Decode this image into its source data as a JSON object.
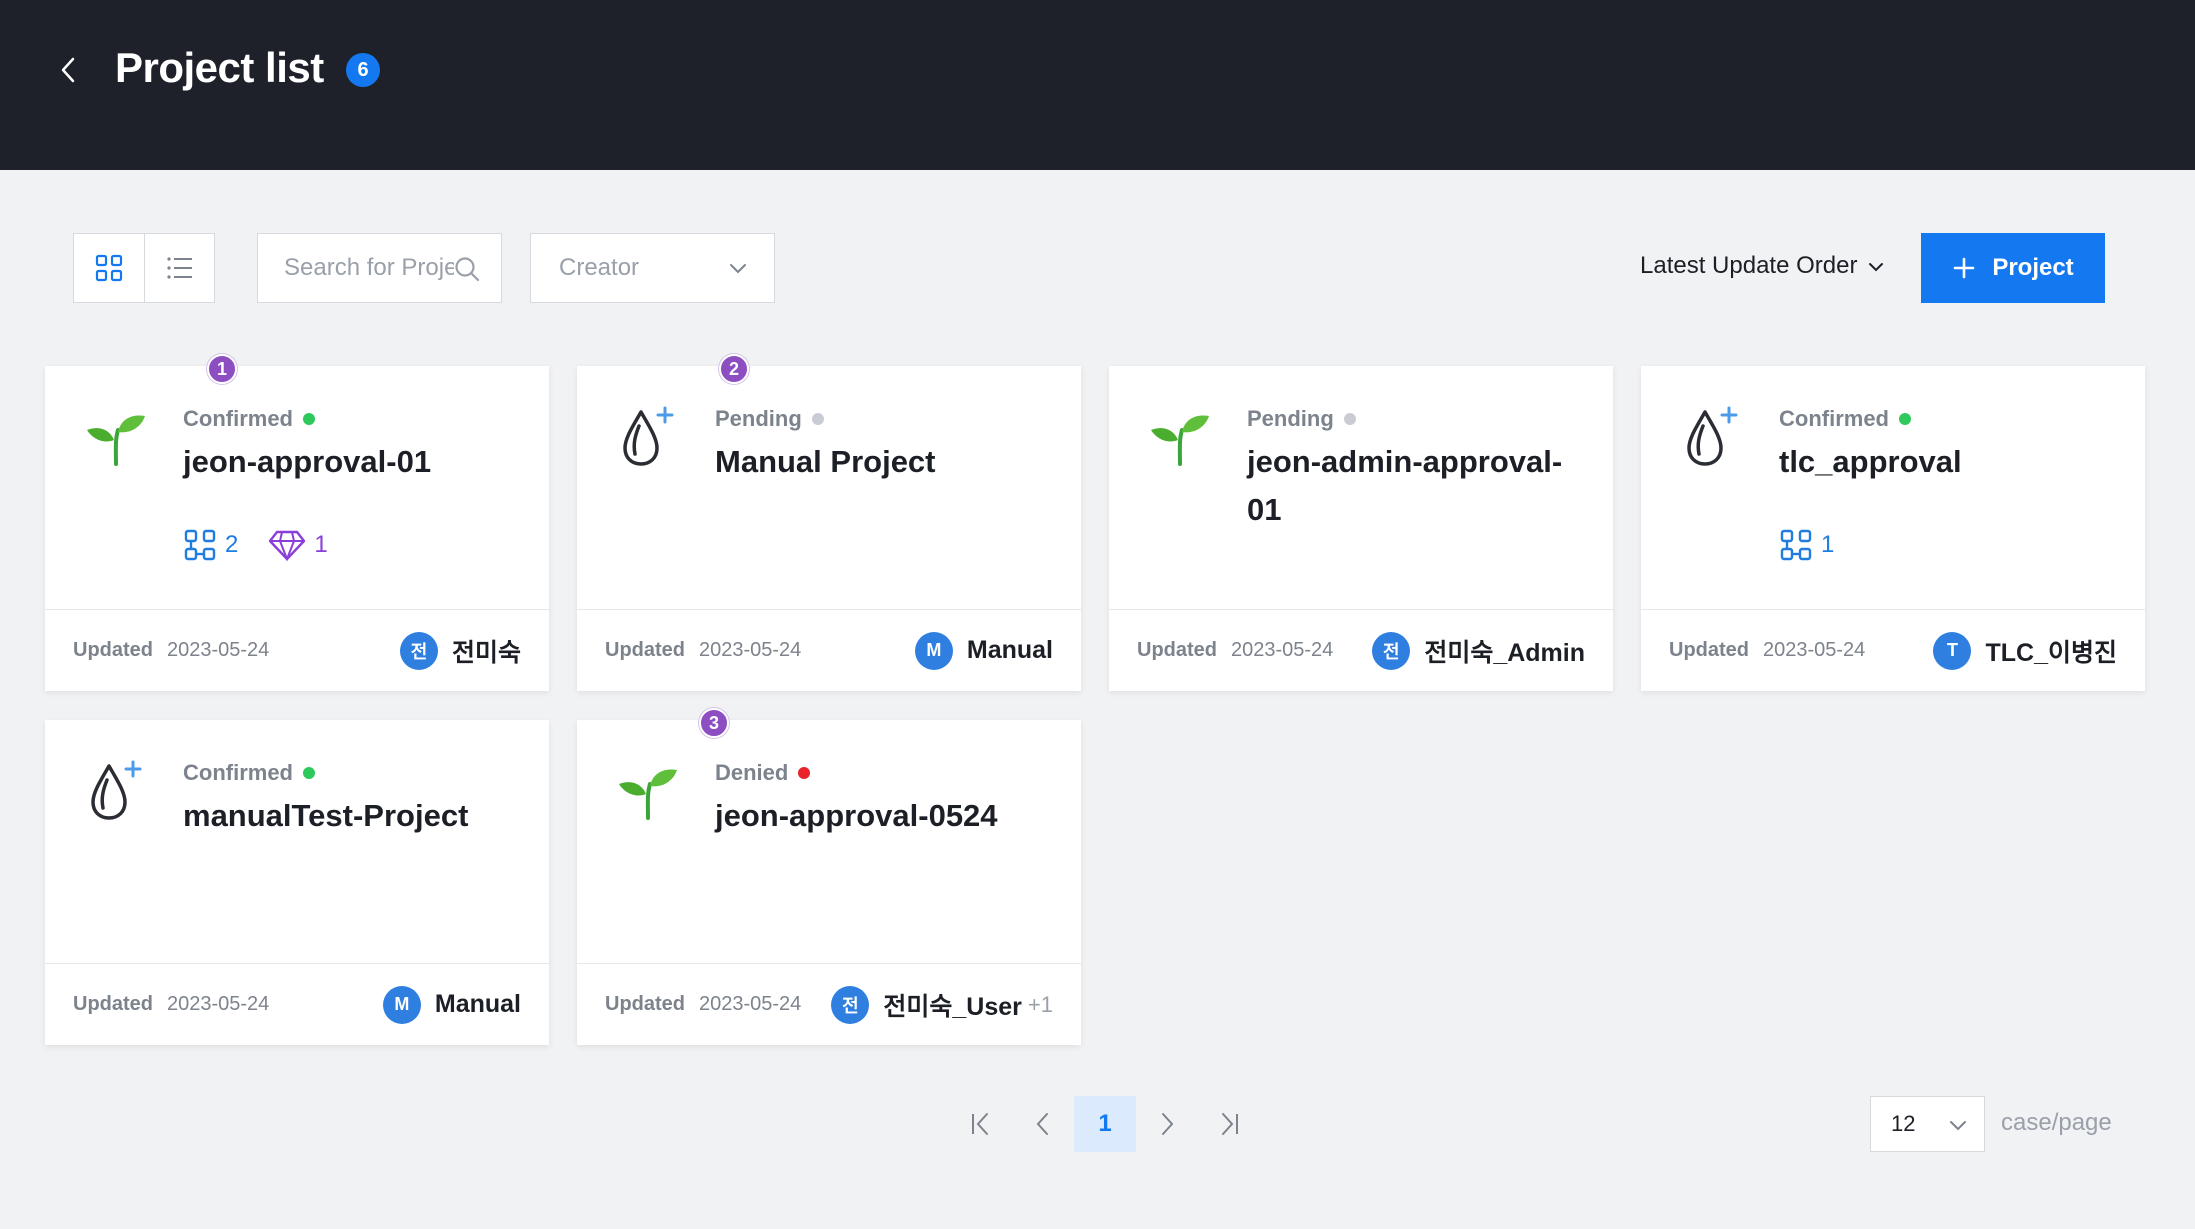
{
  "header": {
    "title": "Project list",
    "count": "6"
  },
  "toolbar": {
    "search_placeholder": "Search for Project",
    "creator_label": "Creator",
    "sort_label": "Latest Update Order",
    "add_project_label": "Project"
  },
  "cards": [
    {
      "status": "Confirmed",
      "status_color": "#2ec95c",
      "notif": "1",
      "name": "jeon-approval-01",
      "icon": "sprout-icon",
      "stats": {
        "models": "2",
        "gems": "1"
      },
      "updated_label": "Updated",
      "updated": "2023-05-24",
      "avatar": "전",
      "creator": "전미숙",
      "extra": ""
    },
    {
      "status": "Pending",
      "status_color": "#c9cdd3",
      "notif": "2",
      "name": "Manual Project",
      "icon": "drop-sparkle-icon",
      "updated_label": "Updated",
      "updated": "2023-05-24",
      "avatar": "M",
      "creator": "Manual",
      "extra": ""
    },
    {
      "status": "Pending",
      "status_color": "#c9cdd3",
      "notif": "",
      "name": "jeon-admin-approval-01",
      "icon": "sprout-icon",
      "updated_label": "Updated",
      "updated": "2023-05-24",
      "avatar": "전",
      "creator": "전미숙_Admin",
      "extra": ""
    },
    {
      "status": "Confirmed",
      "status_color": "#2ec95c",
      "notif": "",
      "name": "tlc_approval",
      "icon": "drop-sparkle-icon",
      "stats": {
        "models": "1"
      },
      "updated_label": "Updated",
      "updated": "2023-05-24",
      "avatar": "T",
      "creator": "TLC_이병진",
      "extra": ""
    },
    {
      "status": "Confirmed",
      "status_color": "#2ec95c",
      "notif": "",
      "name": "manualTest-Project",
      "icon": "drop-sparkle-icon",
      "updated_label": "Updated",
      "updated": "2023-05-24",
      "avatar": "M",
      "creator": "Manual",
      "extra": ""
    },
    {
      "status": "Denied",
      "status_color": "#e8232b",
      "notif": "3",
      "name": "jeon-approval-0524",
      "icon": "sprout-icon",
      "updated_label": "Updated",
      "updated": "2023-05-24",
      "avatar": "전",
      "creator": "전미숙_User",
      "extra": "+1"
    }
  ],
  "pagination": {
    "current": "1",
    "page_size": "12",
    "page_size_label": "case/page"
  },
  "colors": {
    "accent": "#1479f0",
    "header_bg": "#1e2129",
    "notif": "#8c4ec1",
    "confirmed": "#2ec95c",
    "pending": "#c9cdd3",
    "denied": "#e8232b"
  }
}
